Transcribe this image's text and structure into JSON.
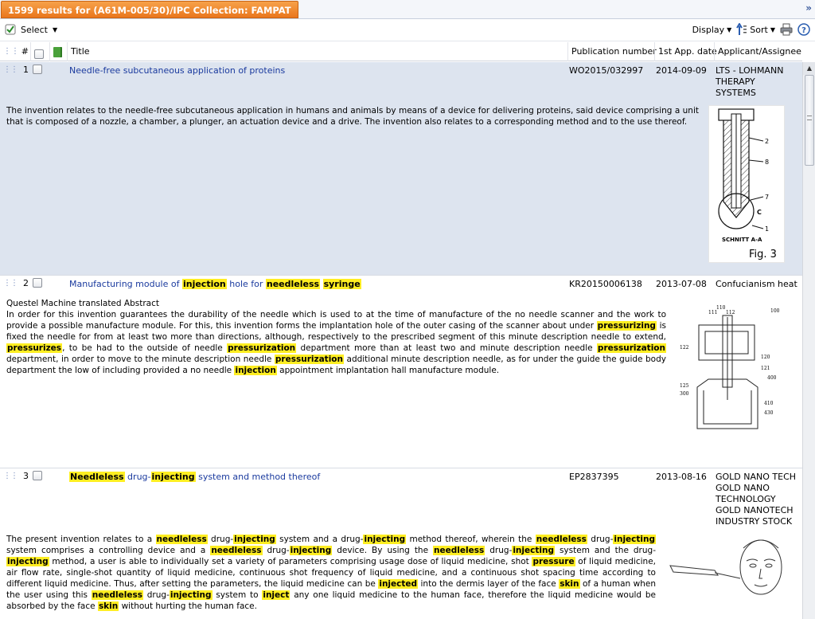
{
  "topbar": {
    "results_tab": "1599 results for (A61M-005/30)/IPC Collection: FAMPAT",
    "collapse": "»"
  },
  "toolbar": {
    "select_label": "Select",
    "display_label": "Display",
    "sort_label": "Sort",
    "icons": [
      "checkmark-icon",
      "sort-arrow-icon",
      "print-icon",
      "help-icon"
    ]
  },
  "columns": {
    "num": "#",
    "title": "Title",
    "pubnum": "Publication number",
    "appdate": "1st App. date",
    "assignee": "Applicant/Assignee"
  },
  "rows": [
    {
      "num": "1",
      "title": "Needle-free subcutaneous application of proteins",
      "pubnum": "WO2015/032997",
      "appdate": "2014-09-09",
      "assignee": [
        "LTS - LOHMANN",
        "THERAPY",
        "SYSTEMS"
      ],
      "abstract_label": "",
      "abstract": "The invention relates to the needle-free subcutaneous application in humans and animals by means of a device for delivering proteins, said device comprising a unit that is composed of a nozzle, a chamber, a plunger, an actuation device and a drive. The invention also relates to a corresponding method and to the use thereof.",
      "figure_labels": [
        "2",
        "8",
        "7",
        "C",
        "1",
        "SCHNITT A-A",
        "Fig. 3"
      ]
    },
    {
      "num": "2",
      "title": "Manufacturing module of [injection] hole for [needleless] [syringe]",
      "pubnum": "KR20150006138",
      "appdate": "2013-07-08",
      "assignee": [
        "Confucianism heat"
      ],
      "abstract_label": "Questel Machine translated Abstract",
      "abstract": "In order for this invention guarantees the durability of the needle which is used to at the time of manufacture of the no needle scanner and the work to provide a possible manufacture module. For this, this invention forms the implantation hole of the outer casing of the scanner about under [pressurizing] is fixed the needle for from at least two more than directions, although, respectively to the prescribed segment of this minute description needle to extend, [pressurizes], to be had to the outside of needle [pressurization] department more than at least two and minute description needle [pressurization] department, in order to move to the minute description needle [pressurization] additional minute description needle, as for under the guide the guide body department the low of including provided a no needle [injection] appointment implantation hall manufacture module.",
      "figure_labels": [
        "110",
        "111",
        "112",
        "100",
        "122",
        "120",
        "121",
        "125",
        "300",
        "400",
        "410",
        "430"
      ]
    },
    {
      "num": "3",
      "title": "[Needleless] drug-[injecting] system and method thereof",
      "pubnum": "EP2837395",
      "appdate": "2013-08-16",
      "assignee": [
        "GOLD NANO TECH",
        "GOLD NANO",
        "TECHNOLOGY",
        "GOLD NANOTECH",
        "INDUSTRY STOCK"
      ],
      "abstract_label": "",
      "abstract": "The present invention relates to a [needleless] drug-[injecting] system and a drug-[injecting] method thereof, wherein the [needleless] drug-[injecting] system comprises a controlling device and a [needleless] drug-[injecting] device. By using the [needleless] drug-[injecting] system and the drug-[injecting] method, a user is able to individually set a variety of parameters comprising usage dose of liquid medicine, shot [pressure] of liquid medicine, air flow rate, single-shot quantity of liquid medicine, continuous shot frequency of liquid medicine, and a continuous shot spacing time according to different liquid medicine. Thus, after setting the parameters, the liquid medicine can be [injected] into the dermis layer of the face [skin] of a human when the user using this [needleless] drug-[injecting] system to [inject] any one liquid medicine to the human face, therefore the liquid medicine would be absorbed by the face [skin] without hurting the human face.",
      "figure_labels": []
    }
  ],
  "colors": {
    "tab_orange": "#e9761c",
    "link_blue": "#1a3a9e",
    "highlight": "#ffee22",
    "selected_row": "#dde4ef"
  }
}
